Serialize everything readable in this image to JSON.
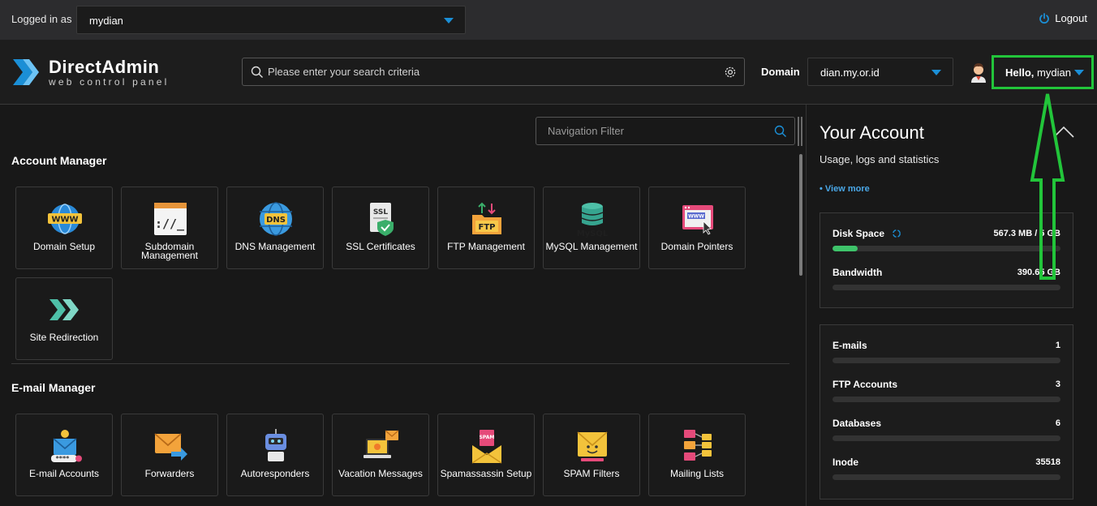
{
  "topbar": {
    "logged_in_label": "Logged in as",
    "user": "mydian",
    "logout_label": "Logout"
  },
  "header": {
    "logo_title": "DirectAdmin",
    "logo_subtitle": "web control panel",
    "search_placeholder": "Please enter your search criteria",
    "domain_label": "Domain",
    "domain_value": "dian.my.or.id",
    "hello_prefix": "Hello,",
    "hello_user": "mydian"
  },
  "main": {
    "nav_filter_placeholder": "Navigation Filter",
    "sections": [
      {
        "title": "Account Manager",
        "items": [
          {
            "label": "Domain Setup",
            "icon": "www-globe-icon"
          },
          {
            "label": "Subdomain Management",
            "icon": "terminal-window-icon"
          },
          {
            "label": "DNS Management",
            "icon": "dns-globe-icon"
          },
          {
            "label": "SSL Certificates",
            "icon": "ssl-certificate-icon"
          },
          {
            "label": "FTP Management",
            "icon": "ftp-folder-icon"
          },
          {
            "label": "MySQL Management",
            "icon": "database-icon"
          },
          {
            "label": "Domain Pointers",
            "icon": "browser-pointer-icon"
          },
          {
            "label": "Site Redirection",
            "icon": "redirect-arrows-icon"
          }
        ]
      },
      {
        "title": "E-mail Manager",
        "items": [
          {
            "label": "E-mail Accounts",
            "icon": "email-account-icon"
          },
          {
            "label": "Forwarders",
            "icon": "envelope-forward-icon"
          },
          {
            "label": "Autoresponders",
            "icon": "robot-icon"
          },
          {
            "label": "Vacation Messages",
            "icon": "vacation-laptop-icon"
          },
          {
            "label": "Spamassassin Setup",
            "icon": "spam-envelope-icon"
          },
          {
            "label": "SPAM Filters",
            "icon": "smiley-envelope-icon"
          },
          {
            "label": "Mailing Lists",
            "icon": "mailing-list-icon"
          }
        ]
      }
    ]
  },
  "account": {
    "title": "Your Account",
    "subtitle": "Usage, logs and statistics",
    "view_more": "• View more",
    "usage": [
      {
        "name": "Disk Space",
        "value": "567.3 MB / 5 GB",
        "fraction": 0.11
      },
      {
        "name": "Bandwidth",
        "value": "390.65 GB",
        "fraction": 0
      }
    ],
    "counts": [
      {
        "name": "E-mails",
        "value": "1",
        "fraction": 0
      },
      {
        "name": "FTP Accounts",
        "value": "3",
        "fraction": 0
      },
      {
        "name": "Databases",
        "value": "6",
        "fraction": 0
      },
      {
        "name": "Inode",
        "value": "35518",
        "fraction": 0
      }
    ]
  },
  "colors": {
    "accent": "#1b8fd6",
    "highlight": "#22c53a",
    "progress": "#3ec36a"
  }
}
